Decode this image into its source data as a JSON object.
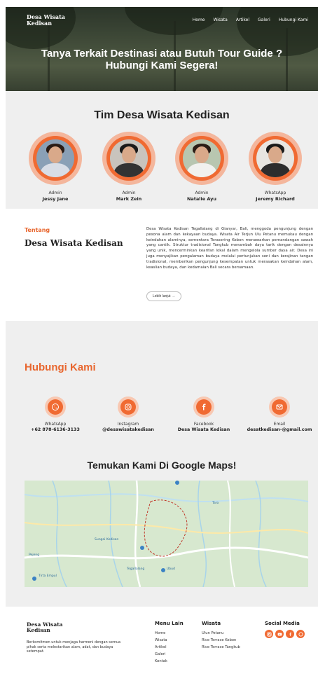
{
  "header": {
    "brand": "Desa Wisata Kedisan",
    "nav": [
      "Home",
      "Wisata",
      "Artikel",
      "Galeri",
      "Hubungi Kami"
    ],
    "hero_title": "Tanya Terkait Destinasi atau Butuh Tour Guide ? Hubungi Kami Segera!"
  },
  "team": {
    "title": "Tim Desa Wisata Kedisan",
    "members": [
      {
        "role": "Admin",
        "name": "Jessy Jane"
      },
      {
        "role": "Admin",
        "name": "Mark Zein"
      },
      {
        "role": "Admin",
        "name": "Natalie Ayu"
      },
      {
        "role": "WhatsApp",
        "name": "Jeremy Richard"
      }
    ]
  },
  "about": {
    "tag": "Tentang",
    "title": "Desa Wisata Kedisan",
    "description": "Desa Wisata Kedisan Tegallalang di Gianyar, Bali, menggoda pengunjung dengan pesona alam dan kekayaan budaya. Wisata Air Terjun Ulu Petanu memukau dengan keindahan alaminya, sementara Terasering Kebon menawarkan pemandangan sawah yang cantik. Struktur tradisional Tangkub menambah daya tarik dengan desainnya yang unik, mencerminkan kearifan lokal dalam mengelola sumber daya air. Desa ini juga menyajikan pengalaman budaya melalui pertunjukan seni dan kerajinan tangan tradisional, memberikan pengunjung kesempatan untuk merasakan keindahan alam, keaslian budaya, dan kedamaian Bali secara bersamaan.",
    "more_label": "Lebih lanjut →"
  },
  "contact": {
    "title": "Hubungi Kami",
    "items": [
      {
        "label": "WhatsApp",
        "value": "+62 878-6136-3133"
      },
      {
        "label": "Instagram",
        "value": "@desawisatakedisan"
      },
      {
        "label": "Facebook",
        "value": "Desa Wisata Kedisan"
      },
      {
        "label": "Email",
        "value": "desatkedisan-@gmail.com"
      }
    ],
    "map_title": "Temukan Kami Di Google Maps!",
    "map_labels": [
      "Pejeng",
      "Tirta Empul",
      "Tegallalang",
      "Sungai Kedisan",
      "Taro",
      "Ubud"
    ]
  },
  "footer": {
    "brand": "Desa Wisata Kedisan",
    "tagline": "Berkomitmen untuk menjaga harmoni dengan semua pihak serta melestarikan alam, adat, dan budaya setempat.",
    "menu_title": "Menu Lain",
    "menu": [
      "Home",
      "Wisata",
      "Artikel",
      "Galeri",
      "Kontak"
    ],
    "wisata_title": "Wisata",
    "wisata": [
      "Ulun Petanu",
      "Rice Terrace Kebon",
      "Rice Terrace Tangkub"
    ],
    "social_title": "Social Media"
  },
  "colors": {
    "accent": "#f06a32",
    "accent_light": "#f4b69c",
    "section_bg": "#efefef"
  }
}
